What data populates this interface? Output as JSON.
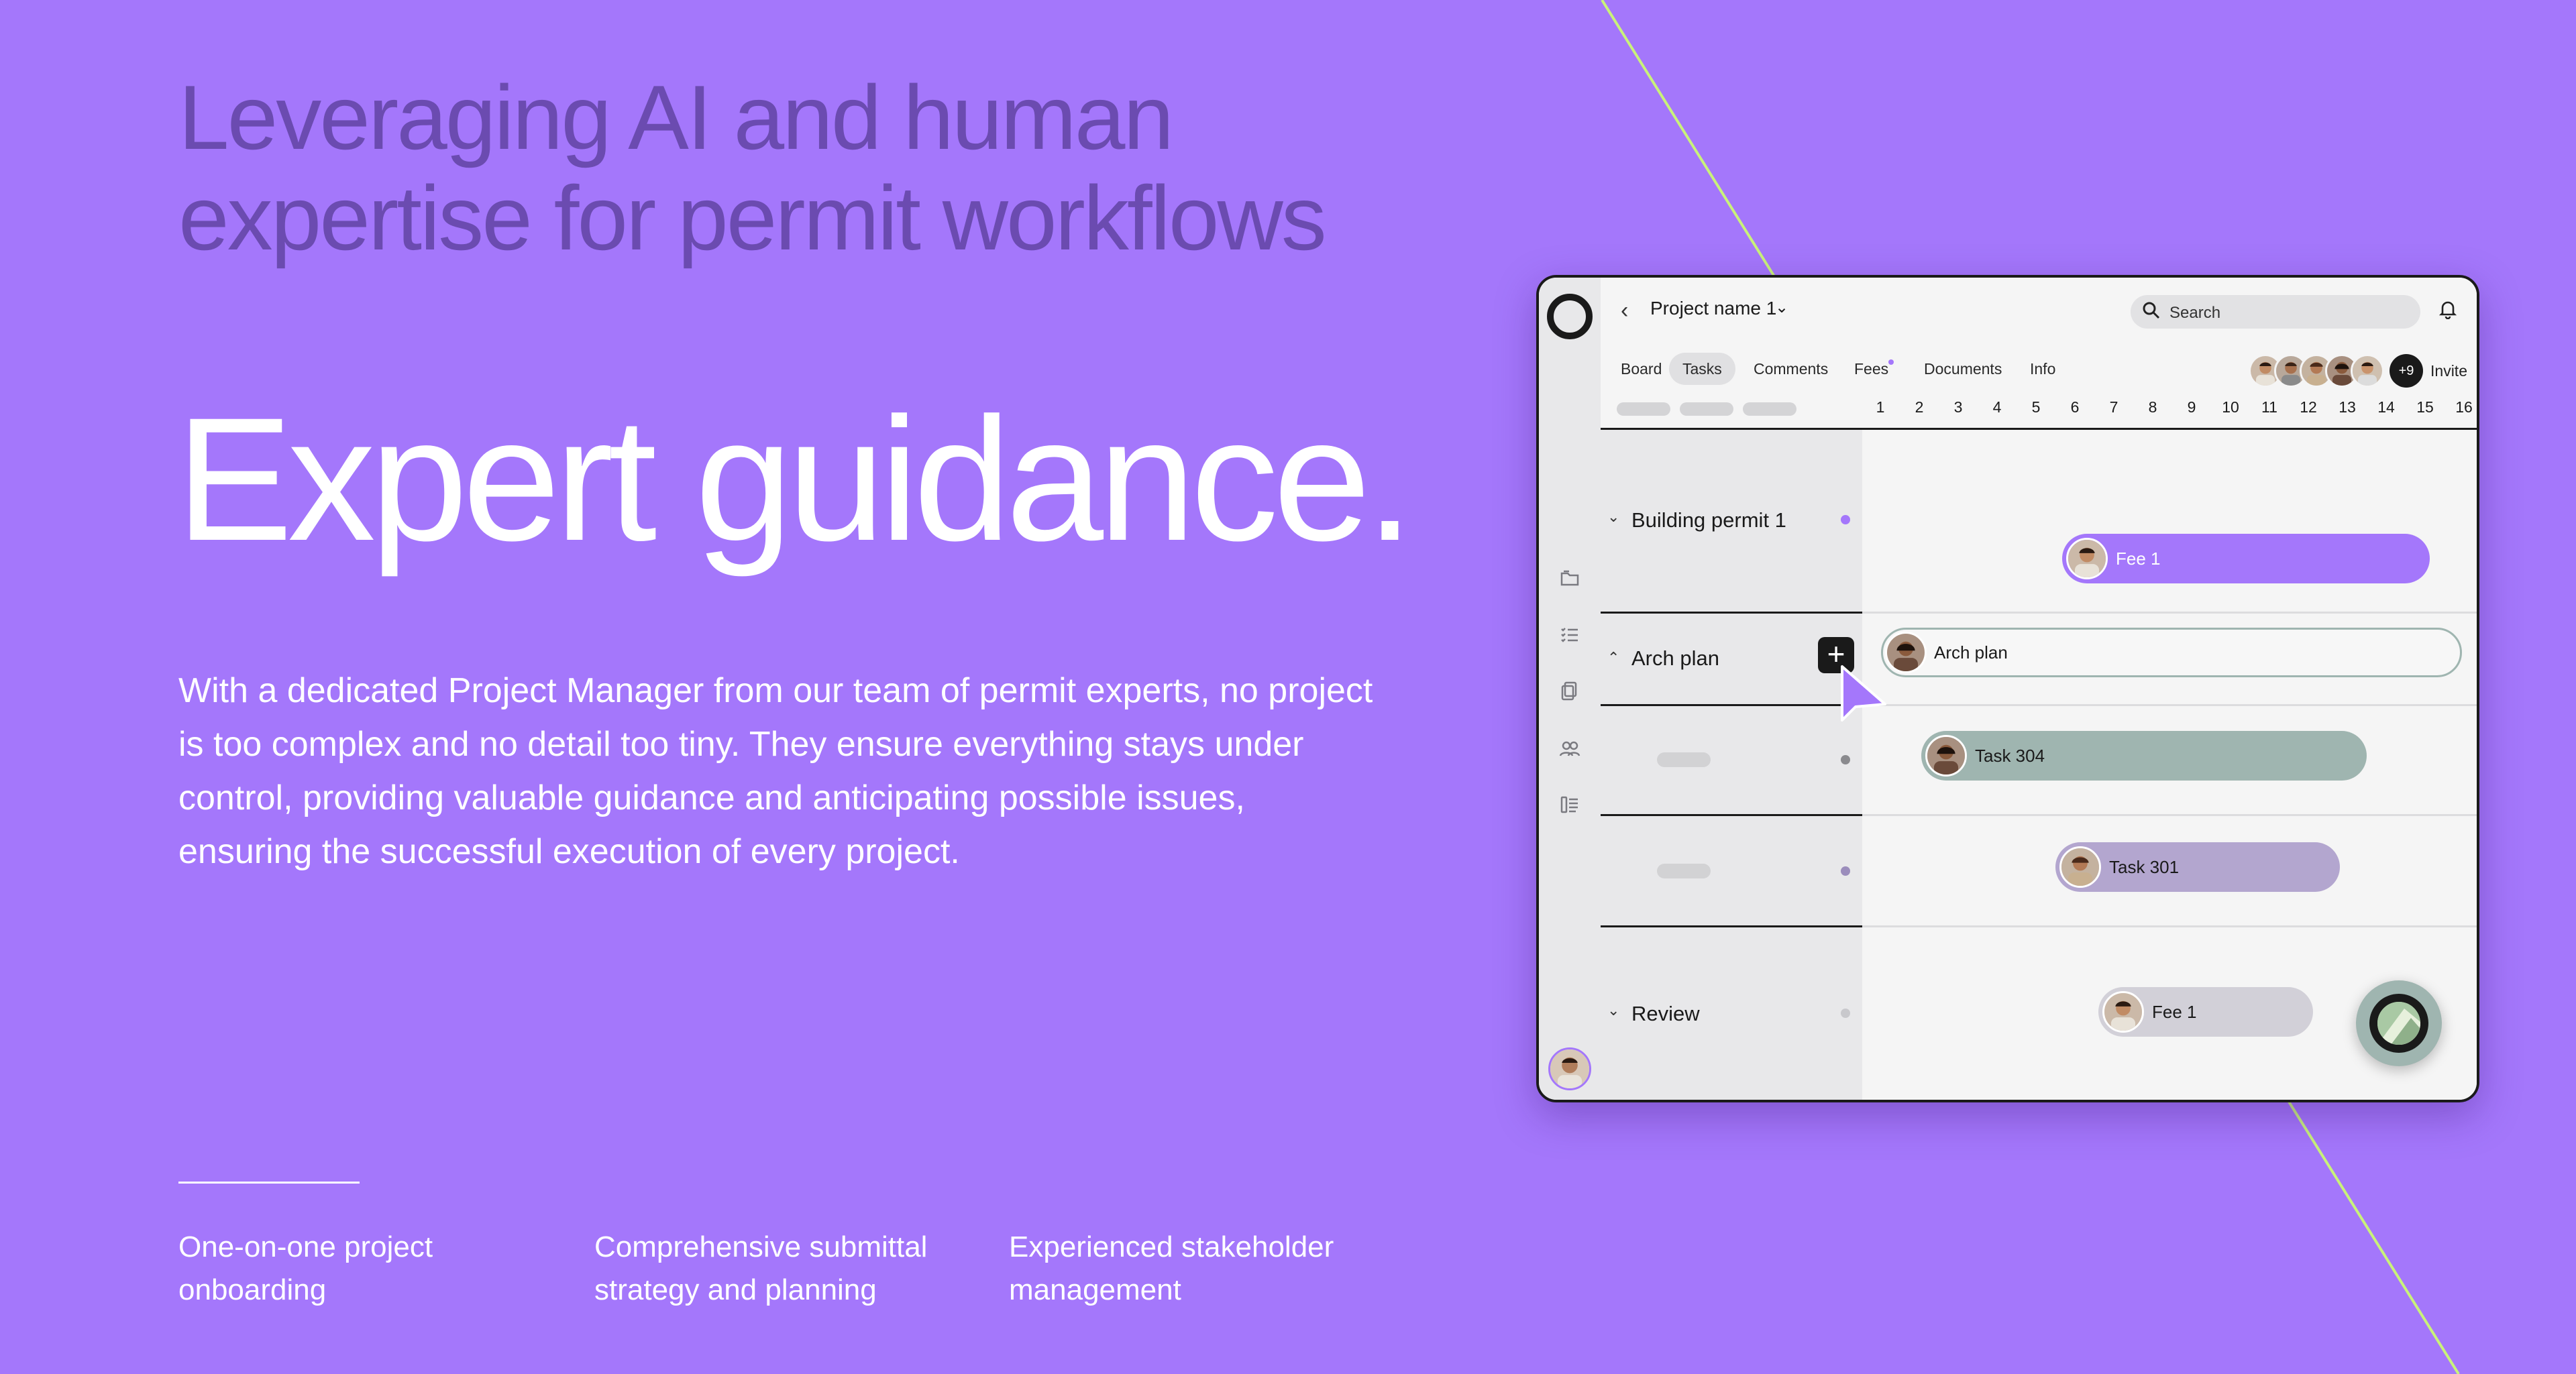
{
  "headline": {
    "line1": "Leveraging AI and human",
    "line2": "expertise for permit workflows"
  },
  "hero": "Expert guidance.",
  "paragraph": "With a dedicated Project Manager from our team of permit experts, no project is too complex and no detail too tiny. They ensure everything stays under control, providing valuable guidance and anticipating possible issues, ensuring the successful execution of every project.",
  "features": [
    "One-on-one project onboarding",
    "Comprehensive submittal strategy and planning",
    "Experienced stakeholder management"
  ],
  "colors": {
    "background": "#a477fb",
    "headline": "#6b4bb0",
    "accent_line": "#c9f27a",
    "fee_bar": "#a477fb",
    "task_green": "#9fb5b0",
    "task_purple": "#b3a6cf",
    "review_bar": "#d2d0d8"
  },
  "app": {
    "project_name": "Project name 1",
    "search_placeholder": "Search",
    "tabs": [
      "Board",
      "Tasks",
      "Comments",
      "Fees",
      "Documents",
      "Info"
    ],
    "active_tab": "Tasks",
    "more_members": "+9",
    "invite_label": "Invite",
    "columns": [
      "1",
      "2",
      "3",
      "4",
      "5",
      "6",
      "7",
      "8",
      "9",
      "10",
      "11",
      "12",
      "13",
      "14",
      "15",
      "16"
    ],
    "groups": {
      "building_permit": "Building permit 1",
      "arch_plan": "Arch plan",
      "review": "Review"
    },
    "bars": {
      "fee1": "Fee 1",
      "arch_plan": "Arch plan",
      "task304": "Task 304",
      "task301": "Task 301",
      "review_fee": "Fee 1"
    }
  }
}
